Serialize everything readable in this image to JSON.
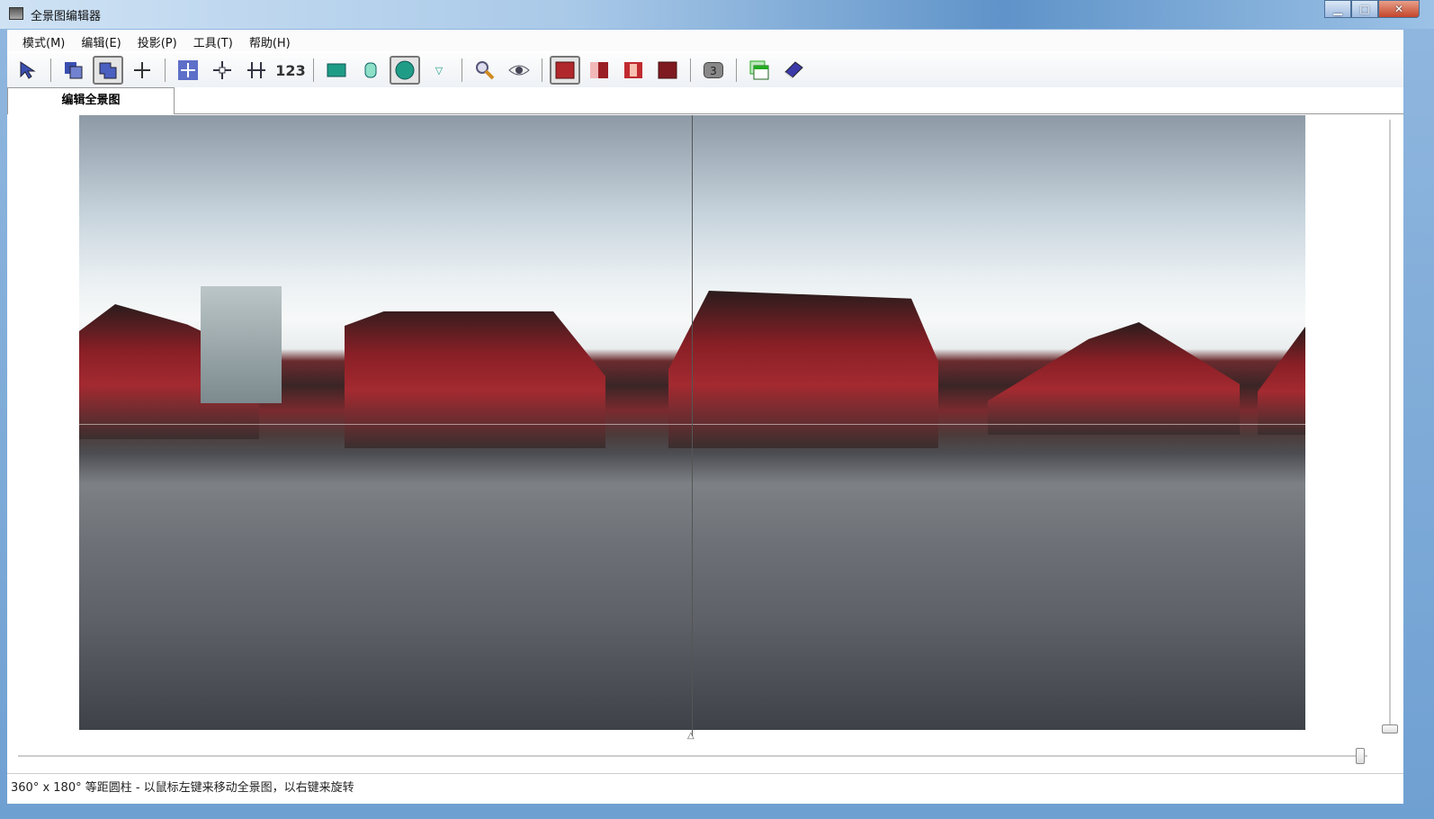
{
  "window": {
    "title": "全景图编辑器",
    "minimize": "▁",
    "maximize": "□",
    "close": "✕"
  },
  "menu": [
    {
      "label": "模式(M)"
    },
    {
      "label": "编辑(E)"
    },
    {
      "label": "投影(P)"
    },
    {
      "label": "工具(T)"
    },
    {
      "label": "帮助(H)"
    }
  ],
  "toolbar": {
    "numbers_label": "123",
    "badge_label": "3"
  },
  "tabs": [
    {
      "label": "编辑全景图"
    }
  ],
  "status": {
    "text": "360° x 180° 等距圆柱 - 以鼠标左键来移动全景图，以右键来旋转"
  },
  "sliders": {
    "horizontal_position": 1.0,
    "vertical_position": 1.0
  }
}
